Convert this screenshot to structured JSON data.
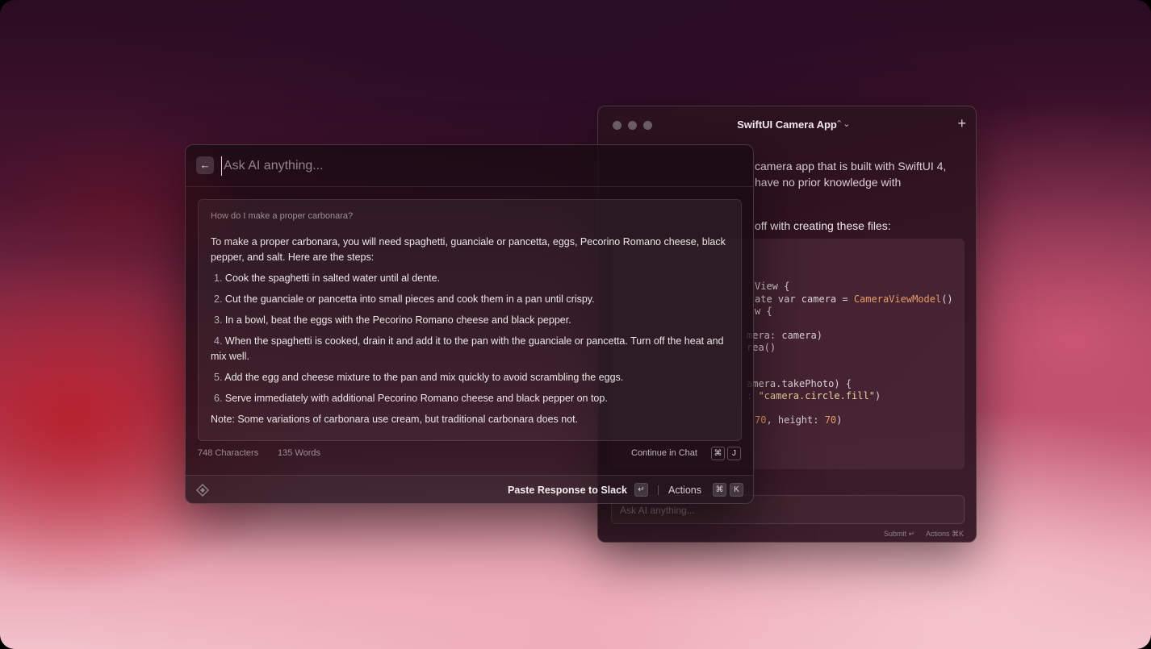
{
  "back_window": {
    "title": "SwiftUI Camera App",
    "title_chevron": "⌃⌄",
    "new_chat": "+",
    "text_line1": "camera app that is built with SwiftUI 4,",
    "text_line2": "have no prior knowledge with",
    "text_line3": "off with creating these files:",
    "code_lines": [
      "View {",
      "ate var camera = CameraViewModel()",
      "w {",
      "",
      "mera: camera)",
      "rea()",
      "",
      "",
      "amera.takePhoto) {",
      ": \"camera.circle.fill\")",
      "",
      "70, height: 70)"
    ],
    "input_placeholder": "Ask AI anything...",
    "submit_hint": "Submit ↵",
    "actions_hint": "Actions ⌘K"
  },
  "front_window": {
    "back_icon": "←",
    "input_placeholder": "Ask AI anything...",
    "question": "How do I make a proper carbonara?",
    "intro": "To make a proper carbonara, you will need spaghetti, guanciale or pancetta, eggs, Pecorino Romano cheese, black pepper, and salt. Here are the steps:",
    "steps": [
      {
        "num": "1.",
        "text": "Cook the spaghetti in salted water until al dente."
      },
      {
        "num": "2.",
        "text": "Cut the guanciale or pancetta into small pieces and cook them in a pan until crispy."
      },
      {
        "num": "3.",
        "text": "In a bowl, beat the eggs with the Pecorino Romano cheese and black pepper."
      },
      {
        "num": "4.",
        "text": "When the spaghetti is cooked, drain it and add it to the pan with the guanciale or pancetta. Turn off the heat and mix well."
      },
      {
        "num": "5.",
        "text": "Add the egg and cheese mixture to the pan and mix quickly to avoid scrambling the eggs."
      },
      {
        "num": "6.",
        "text": "Serve immediately with additional Pecorino Romano cheese and black pepper on top."
      }
    ],
    "note": "Note: Some variations of carbonara use cream, but traditional carbonara does not.",
    "characters": "748 Characters",
    "words": "135 Words",
    "continue_label": "Continue in Chat",
    "continue_keys": [
      "⌘",
      "J"
    ],
    "paste_label": "Paste Response to Slack",
    "paste_key": "↵",
    "actions_label": "Actions",
    "actions_keys": [
      "⌘",
      "K"
    ]
  }
}
